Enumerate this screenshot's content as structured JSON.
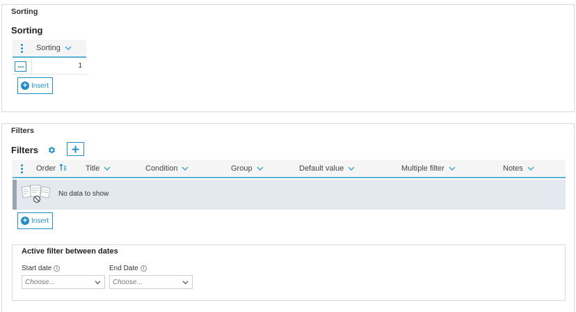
{
  "sorting_panel": {
    "legend": "Sorting",
    "title": "Sorting",
    "grid": {
      "column": "Sorting",
      "rows": [
        {
          "value": "1"
        }
      ]
    },
    "insert_label": "Insert"
  },
  "filters_panel": {
    "legend": "Filters",
    "title": "Filters",
    "columns": [
      "Order",
      "Title",
      "Condition",
      "Group",
      "Default value",
      "Multiple filter",
      "Notes"
    ],
    "empty_text": "No data to show",
    "insert_label": "Insert"
  },
  "active_filter": {
    "title": "Active filter between dates",
    "start_label": "Start date",
    "end_label": "End Date",
    "start_placeholder": "Choose...",
    "end_placeholder": "Choose..."
  },
  "colors": {
    "accent": "#1f8fc9",
    "header_underline": "#5ab1d6",
    "empty_row_bg": "#e4e9f0"
  }
}
